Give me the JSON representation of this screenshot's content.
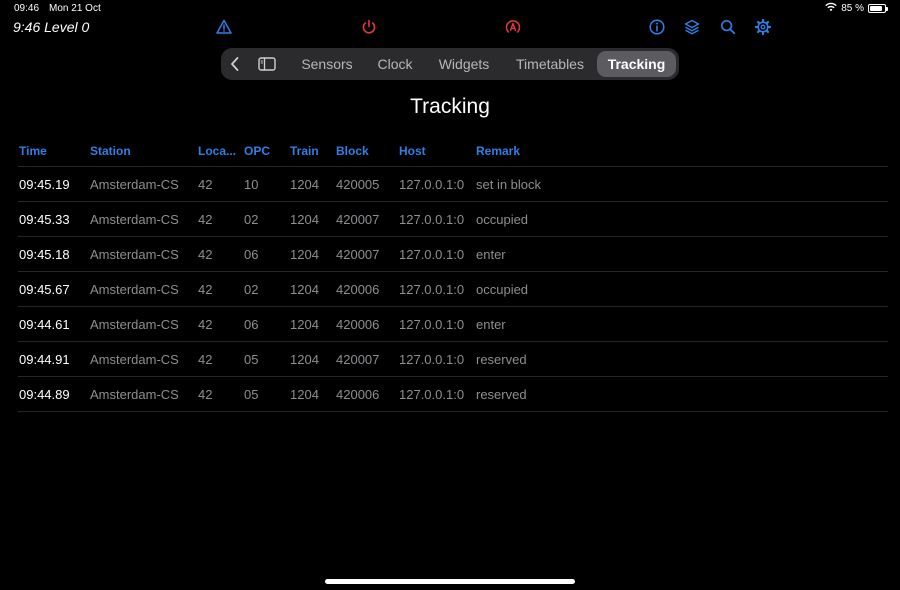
{
  "status_bar": {
    "time": "09:46",
    "date": "Mon 21 Oct",
    "battery": "85 %",
    "battery_level": 0.85
  },
  "header": {
    "level_label": "9:46 Level 0"
  },
  "toolbar_icons": [
    {
      "name": "warning-icon",
      "color": "#2f7fe6"
    },
    {
      "name": "power-icon",
      "color": "#e53935"
    },
    {
      "name": "auto-mode-icon",
      "color": "#e53935"
    },
    {
      "name": "info-icon",
      "color": "#2f7fe6"
    },
    {
      "name": "layers-icon",
      "color": "#2f7fe6"
    },
    {
      "name": "search-icon",
      "color": "#2f7fe6"
    },
    {
      "name": "gear-icon",
      "color": "#2f7fe6"
    }
  ],
  "nav": {
    "back_icon": "chevron-left-icon",
    "sidebar_icon": "sidebar-icon",
    "tabs": [
      {
        "label": "Sensors",
        "active": false
      },
      {
        "label": "Clock",
        "active": false
      },
      {
        "label": "Widgets",
        "active": false
      },
      {
        "label": "Timetables",
        "active": false
      },
      {
        "label": "Tracking",
        "active": true
      }
    ]
  },
  "page": {
    "title": "Tracking"
  },
  "table": {
    "columns": [
      "Time",
      "Station",
      "Loca...",
      "OPC",
      "Train",
      "Block",
      "Host",
      "Remark"
    ],
    "rows": [
      [
        "09:45.19",
        "Amsterdam-CS",
        "42",
        "10",
        "1204",
        "420005",
        "127.0.0.1:0",
        "set in block"
      ],
      [
        "09:45.33",
        "Amsterdam-CS",
        "42",
        "02",
        "1204",
        "420007",
        "127.0.0.1:0",
        "occupied"
      ],
      [
        "09:45.18",
        "Amsterdam-CS",
        "42",
        "06",
        "1204",
        "420007",
        "127.0.0.1:0",
        "enter"
      ],
      [
        "09:45.67",
        "Amsterdam-CS",
        "42",
        "02",
        "1204",
        "420006",
        "127.0.0.1:0",
        "occupied"
      ],
      [
        "09:44.61",
        "Amsterdam-CS",
        "42",
        "06",
        "1204",
        "420006",
        "127.0.0.1:0",
        "enter"
      ],
      [
        "09:44.91",
        "Amsterdam-CS",
        "42",
        "05",
        "1204",
        "420007",
        "127.0.0.1:0",
        "reserved"
      ],
      [
        "09:44.89",
        "Amsterdam-CS",
        "42",
        "05",
        "1204",
        "420006",
        "127.0.0.1:0",
        "reserved"
      ]
    ]
  },
  "colors": {
    "accent": "#2f7fe6",
    "alert": "#e53935",
    "muted_text": "#8e8e93"
  }
}
